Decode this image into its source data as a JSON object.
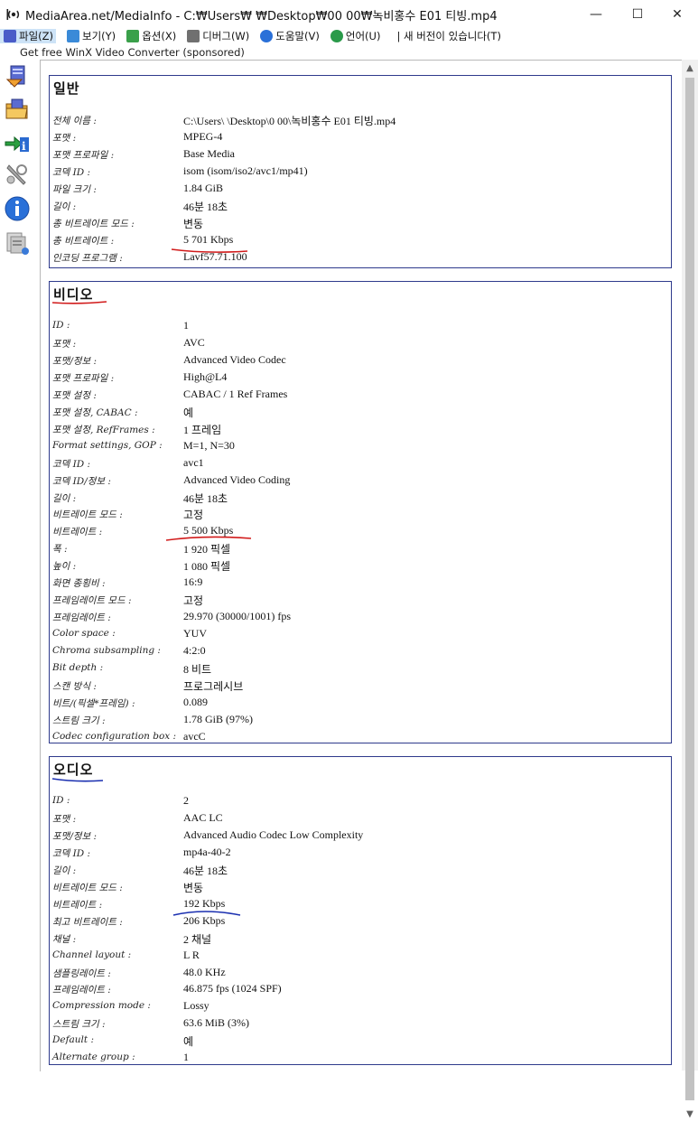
{
  "window": {
    "title": "MediaArea.net/MediaInfo - C:₩Users₩ ₩Desktop₩00 00₩녹비홍수 E01 티빙.mp4",
    "minimize": "—",
    "maximize": "☐",
    "close": "✕"
  },
  "menu": {
    "items": [
      {
        "label": "파일(Z)",
        "icon": "file-icon"
      },
      {
        "label": "보기(Y)",
        "icon": "view-icon"
      },
      {
        "label": "옵션(X)",
        "icon": "options-icon"
      },
      {
        "label": "디버그(W)",
        "icon": "debug-icon"
      },
      {
        "label": "도움말(V)",
        "icon": "help-icon"
      },
      {
        "label": "언어(U)",
        "icon": "language-icon"
      },
      {
        "label": "| 새 버전이 있습니다(T)",
        "icon": ""
      }
    ]
  },
  "sponsor": "Get free WinX Video Converter (sponsored)",
  "sidebar": {
    "icons": [
      "open-file-icon",
      "open-folder-icon",
      "export-icon",
      "preferences-icon",
      "about-icon",
      "sheet-view-icon"
    ]
  },
  "sections": [
    {
      "title": "일반",
      "rows": [
        {
          "label": "전체 이름 :",
          "value": "C:\\Users\\ \\Desktop\\0 00\\녹비홍수 E01 티빙.mp4"
        },
        {
          "label": "포맷 :",
          "value": "MPEG-4"
        },
        {
          "label": "포맷 프로파일 :",
          "value": "Base Media"
        },
        {
          "label": "코덱 ID :",
          "value": "isom (isom/iso2/avc1/mp41)"
        },
        {
          "label": "파일 크기 :",
          "value": "1.84 GiB"
        },
        {
          "label": "길이 :",
          "value": "46분 18초"
        },
        {
          "label": "총 비트레이트 모드 :",
          "value": "변동"
        },
        {
          "label": "총 비트레이트 :",
          "value": "5 701 Kbps"
        },
        {
          "label": "인코딩 프로그램 :",
          "value": "Lavf57.71.100"
        }
      ]
    },
    {
      "title": "비디오",
      "rows": [
        {
          "label": "ID :",
          "value": "1"
        },
        {
          "label": "포맷 :",
          "value": "AVC"
        },
        {
          "label": "포맷/정보 :",
          "value": "Advanced Video Codec"
        },
        {
          "label": "포맷 프로파일 :",
          "value": "High@L4"
        },
        {
          "label": "포맷 설정 :",
          "value": "CABAC / 1 Ref Frames"
        },
        {
          "label": "포맷 설정, CABAC :",
          "value": "예"
        },
        {
          "label": "포맷 설정, RefFrames :",
          "value": "1 프레임"
        },
        {
          "label": "Format settings, GOP :",
          "value": "M=1, N=30"
        },
        {
          "label": "코덱 ID :",
          "value": "avc1"
        },
        {
          "label": "코덱 ID/정보 :",
          "value": "Advanced Video Coding"
        },
        {
          "label": "길이 :",
          "value": "46분 18초"
        },
        {
          "label": "비트레이트 모드 :",
          "value": "고정"
        },
        {
          "label": "비트레이트 :",
          "value": "5 500 Kbps"
        },
        {
          "label": "폭 :",
          "value": "1 920 픽셀"
        },
        {
          "label": "높이 :",
          "value": "1 080 픽셀"
        },
        {
          "label": "화면 종횡비 :",
          "value": "16:9"
        },
        {
          "label": "프레임레이트 모드 :",
          "value": "고정"
        },
        {
          "label": "프레임레이트 :",
          "value": "29.970 (30000/1001) fps"
        },
        {
          "label": "Color space :",
          "value": "YUV"
        },
        {
          "label": "Chroma subsampling :",
          "value": "4:2:0"
        },
        {
          "label": "Bit depth :",
          "value": "8 비트"
        },
        {
          "label": "스캔 방식 :",
          "value": "프로그레시브"
        },
        {
          "label": "비트/(픽셀*프레임) :",
          "value": "0.089"
        },
        {
          "label": "스트림 크기 :",
          "value": "1.78 GiB (97%)"
        },
        {
          "label": "Codec configuration box :",
          "value": "avcC"
        }
      ]
    },
    {
      "title": "오디오",
      "rows": [
        {
          "label": "ID :",
          "value": "2"
        },
        {
          "label": "포맷 :",
          "value": "AAC LC"
        },
        {
          "label": "포맷/정보 :",
          "value": "Advanced Audio Codec Low Complexity"
        },
        {
          "label": "코덱 ID :",
          "value": "mp4a-40-2"
        },
        {
          "label": "길이 :",
          "value": "46분 18초"
        },
        {
          "label": "비트레이트 모드 :",
          "value": "변동"
        },
        {
          "label": "비트레이트 :",
          "value": "192 Kbps"
        },
        {
          "label": "최고 비트레이트 :",
          "value": "206 Kbps"
        },
        {
          "label": "채널 :",
          "value": "2 채널"
        },
        {
          "label": "Channel layout :",
          "value": "L R"
        },
        {
          "label": "샘플링레이트 :",
          "value": "48.0 KHz"
        },
        {
          "label": "프레임레이트 :",
          "value": "46.875 fps (1024 SPF)"
        },
        {
          "label": "Compression mode :",
          "value": "Lossy"
        },
        {
          "label": "스트림 크기 :",
          "value": "63.6 MiB (3%)"
        },
        {
          "label": "Default :",
          "value": "예"
        },
        {
          "label": "Alternate group :",
          "value": "1"
        }
      ]
    }
  ],
  "colors": {
    "section_border": "#2e3a8c",
    "annotation_red": "#d11a1a",
    "annotation_blue": "#1a2fb0"
  }
}
